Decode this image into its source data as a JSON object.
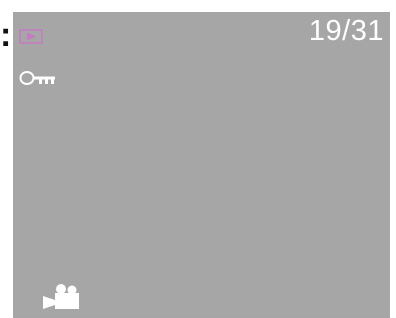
{
  "lead_mark": ":",
  "status": {
    "counter": "19/31",
    "mode_icon": "playback-icon",
    "lock_icon": "key-icon",
    "type_icon": "video-camera-icon"
  },
  "colors": {
    "screen_bg": "#a6a6a6",
    "mode_icon": "#c67ac3",
    "foreground": "#ffffff"
  }
}
